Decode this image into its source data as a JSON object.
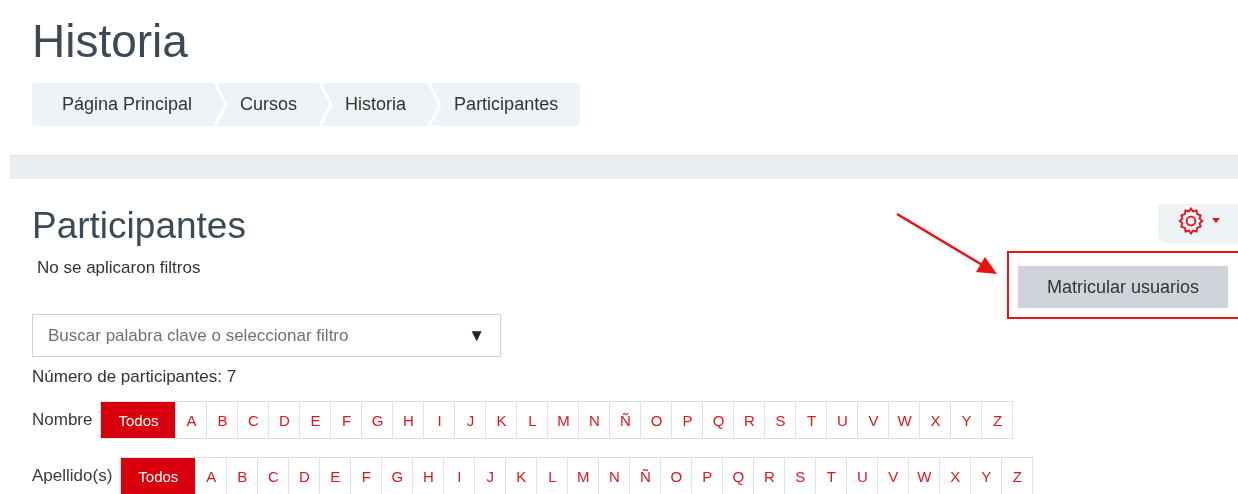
{
  "page_title": "Historia",
  "breadcrumb": [
    {
      "label": "Página Principal"
    },
    {
      "label": "Cursos"
    },
    {
      "label": "Historia"
    },
    {
      "label": "Participantes"
    }
  ],
  "section_title": "Participantes",
  "filter_status": "No se aplicaron filtros",
  "enrol_button": "Matricular usuarios",
  "search": {
    "placeholder": "Buscar palabra clave o seleccionar filtro",
    "caret": "▼"
  },
  "participant_count": "Número de participantes: 7",
  "initials_bars": [
    {
      "label": "Nombre",
      "items": [
        {
          "label": "Todos",
          "selected": true
        },
        {
          "label": "A",
          "selected": false
        },
        {
          "label": "B",
          "selected": false
        },
        {
          "label": "C",
          "selected": false
        },
        {
          "label": "D",
          "selected": false
        },
        {
          "label": "E",
          "selected": false
        },
        {
          "label": "F",
          "selected": false
        },
        {
          "label": "G",
          "selected": false
        },
        {
          "label": "H",
          "selected": false
        },
        {
          "label": "I",
          "selected": false
        },
        {
          "label": "J",
          "selected": false
        },
        {
          "label": "K",
          "selected": false
        },
        {
          "label": "L",
          "selected": false
        },
        {
          "label": "M",
          "selected": false
        },
        {
          "label": "N",
          "selected": false
        },
        {
          "label": "Ñ",
          "selected": false
        },
        {
          "label": "O",
          "selected": false
        },
        {
          "label": "P",
          "selected": false
        },
        {
          "label": "Q",
          "selected": false
        },
        {
          "label": "R",
          "selected": false
        },
        {
          "label": "S",
          "selected": false
        },
        {
          "label": "T",
          "selected": false
        },
        {
          "label": "U",
          "selected": false
        },
        {
          "label": "V",
          "selected": false
        },
        {
          "label": "W",
          "selected": false
        },
        {
          "label": "X",
          "selected": false
        },
        {
          "label": "Y",
          "selected": false
        },
        {
          "label": "Z",
          "selected": false
        }
      ]
    },
    {
      "label": "Apellido(s)",
      "items": [
        {
          "label": "Todos",
          "selected": true
        },
        {
          "label": "A",
          "selected": false
        },
        {
          "label": "B",
          "selected": false
        },
        {
          "label": "C",
          "selected": false
        },
        {
          "label": "D",
          "selected": false
        },
        {
          "label": "E",
          "selected": false
        },
        {
          "label": "F",
          "selected": false
        },
        {
          "label": "G",
          "selected": false
        },
        {
          "label": "H",
          "selected": false
        },
        {
          "label": "I",
          "selected": false
        },
        {
          "label": "J",
          "selected": false
        },
        {
          "label": "K",
          "selected": false
        },
        {
          "label": "L",
          "selected": false
        },
        {
          "label": "M",
          "selected": false
        },
        {
          "label": "N",
          "selected": false
        },
        {
          "label": "Ñ",
          "selected": false
        },
        {
          "label": "O",
          "selected": false
        },
        {
          "label": "P",
          "selected": false
        },
        {
          "label": "Q",
          "selected": false
        },
        {
          "label": "R",
          "selected": false
        },
        {
          "label": "S",
          "selected": false
        },
        {
          "label": "T",
          "selected": false
        },
        {
          "label": "U",
          "selected": false
        },
        {
          "label": "V",
          "selected": false
        },
        {
          "label": "W",
          "selected": false
        },
        {
          "label": "X",
          "selected": false
        },
        {
          "label": "Y",
          "selected": false
        },
        {
          "label": "Z",
          "selected": false
        }
      ]
    }
  ]
}
